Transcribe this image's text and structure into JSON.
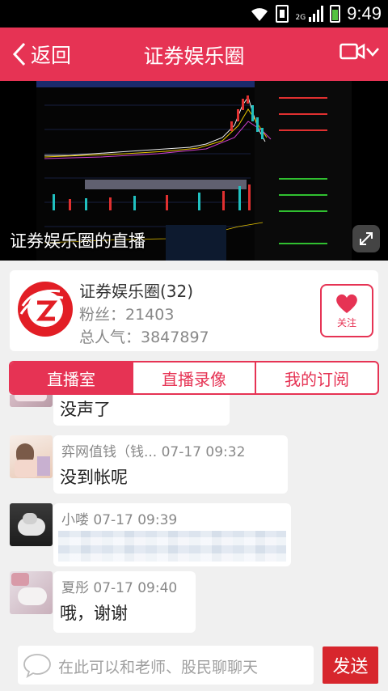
{
  "status_bar": {
    "network": "2G",
    "time": "9:49",
    "icons": [
      "wifi-icon",
      "sim-icon",
      "signal-icon",
      "battery-icon"
    ]
  },
  "header": {
    "back_label": "返回",
    "title": "证券娱乐圈",
    "camera_icon": "video-camera-icon"
  },
  "video": {
    "caption": "证券娱乐圈的直播",
    "expand_icon": "expand-icon"
  },
  "profile": {
    "name": "证券娱乐圈(32)",
    "fans": "粉丝：21403",
    "popularity": "总人气：3847897",
    "follow_label": "关注"
  },
  "tabs": [
    {
      "label": "直播室",
      "active": true
    },
    {
      "label": "直播录像",
      "active": false
    },
    {
      "label": "我的订阅",
      "active": false
    }
  ],
  "messages": [
    {
      "meta": "",
      "text": "没声了"
    },
    {
      "meta": "弈网值钱（钱...   07-17 09:32",
      "text": "没到帐呢"
    },
    {
      "meta": "小喽 07-17 09:39",
      "text": ""
    },
    {
      "meta": "夏彤 07-17 09:40",
      "text": "哦，谢谢"
    }
  ],
  "input": {
    "placeholder": "在此可以和老师、股民聊聊天",
    "send_label": "发送"
  },
  "colors": {
    "accent": "#e63354",
    "send": "#d7262d",
    "background": "#f0f0f0"
  }
}
